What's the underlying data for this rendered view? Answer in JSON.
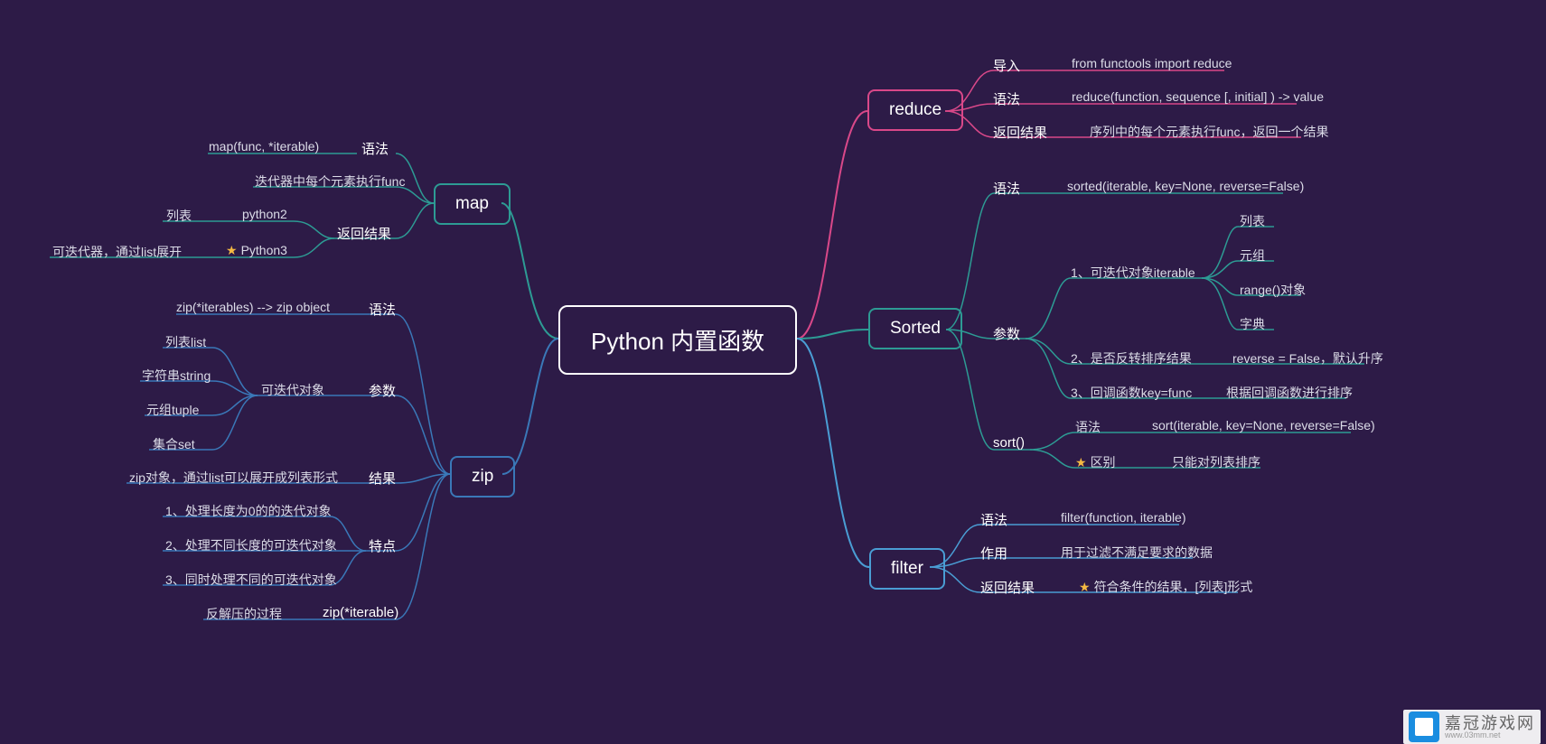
{
  "center": "Python 内置函数",
  "branches": {
    "map": "map",
    "zip": "zip",
    "reduce": "reduce",
    "sorted": "Sorted",
    "filter": "filter"
  },
  "map": {
    "syntax_label": "语法",
    "syntax_value": "map(func, *iterable)",
    "exec": "迭代器中每个元素执行func",
    "return_label": "返回结果",
    "py2": "python2",
    "py2_val": "列表",
    "py3": "Python3",
    "py3_val": "可迭代器，通过list展开"
  },
  "zip": {
    "syntax_label": "语法",
    "syntax_value": "zip(*iterables) --> zip object",
    "param_label": "参数",
    "param_value": "可迭代对象",
    "p1": "列表list",
    "p2": "字符串string",
    "p3": "元组tuple",
    "p4": "集合set",
    "result_label": "结果",
    "result_value": "zip对象，通过list可以展开成列表形式",
    "feat_label": "特点",
    "feat1": "1、处理长度为0的的迭代对象",
    "feat2": "2、处理不同长度的可迭代对象",
    "feat3": "3、同时处理不同的可迭代对象",
    "unzip_label": "zip(*iterable)",
    "unzip_value": "反解压的过程"
  },
  "reduce": {
    "import_label": "导入",
    "import_value": "from functools import reduce",
    "syntax_label": "语法",
    "syntax_value": "reduce(function, sequence [, initial] ) -> value",
    "return_label": "返回结果",
    "return_value": "序列中的每个元素执行func，返回一个结果"
  },
  "sorted": {
    "syntax_label": "语法",
    "syntax_value": "sorted(iterable, key=None, reverse=False)",
    "param_label": "参数",
    "p1": "1、可迭代对象iterable",
    "p1a": "列表",
    "p1b": "元组",
    "p1c": "range()对象",
    "p1d": "字典",
    "p2": "2、是否反转排序结果",
    "p2v": "reverse = False，默认升序",
    "p3": "3、回调函数key=func",
    "p3v": "根据回调函数进行排序",
    "sort_label": "sort()",
    "sort_syntax_label": "语法",
    "sort_syntax_value": "sort(iterable, key=None, reverse=False)",
    "diff_label": "区别",
    "diff_value": "只能对列表排序"
  },
  "filter": {
    "syntax_label": "语法",
    "syntax_value": "filter(function, iterable)",
    "use_label": "作用",
    "use_value": "用于过滤不满足要求的数据",
    "return_label": "返回结果",
    "return_value": "符合条件的结果，[列表]形式"
  },
  "watermark": {
    "main": "嘉冠游戏网",
    "sub": "www.03mm.net"
  }
}
